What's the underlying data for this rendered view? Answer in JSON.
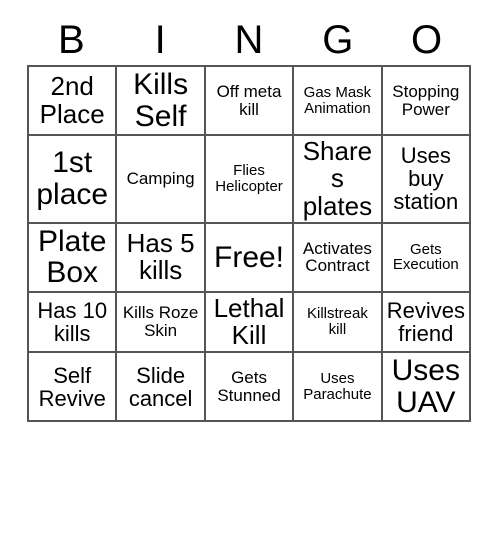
{
  "card": {
    "header": {
      "letters": [
        "B",
        "I",
        "N",
        "G",
        "O"
      ]
    },
    "rows": [
      [
        {
          "text": "2nd Place",
          "size": "sz-lg"
        },
        {
          "text": "Kills Self",
          "size": "sz-xl"
        },
        {
          "text": "Off meta kill",
          "size": "sz-sm"
        },
        {
          "text": "Gas Mask Animation",
          "size": "sz-xs"
        },
        {
          "text": "Stopping Power",
          "size": "sz-sm"
        }
      ],
      [
        {
          "text": "1st place",
          "size": "sz-xl"
        },
        {
          "text": "Camping",
          "size": "sz-sm"
        },
        {
          "text": "Flies Helicopter",
          "size": "sz-xs"
        },
        {
          "text": "Shares plates",
          "size": "sz-lg"
        },
        {
          "text": "Uses buy station",
          "size": "sz-md"
        }
      ],
      [
        {
          "text": "Plate Box",
          "size": "sz-xl"
        },
        {
          "text": "Has 5 kills",
          "size": "sz-lg"
        },
        {
          "text": "Free!",
          "size": "sz-xl"
        },
        {
          "text": "Activates Contract",
          "size": "sz-sm"
        },
        {
          "text": "Gets Execution",
          "size": "sz-xs"
        }
      ],
      [
        {
          "text": "Has 10 kills",
          "size": "sz-md"
        },
        {
          "text": "Kills Roze Skin",
          "size": "sz-sm"
        },
        {
          "text": "Lethal Kill",
          "size": "sz-lg"
        },
        {
          "text": "Killstreak kill",
          "size": "sz-xs"
        },
        {
          "text": "Revives friend",
          "size": "sz-md"
        }
      ],
      [
        {
          "text": "Self Revive",
          "size": "sz-md"
        },
        {
          "text": "Slide cancel",
          "size": "sz-md"
        },
        {
          "text": "Gets Stunned",
          "size": "sz-sm"
        },
        {
          "text": "Uses Parachute",
          "size": "sz-xs"
        },
        {
          "text": "Uses UAV",
          "size": "sz-xl"
        }
      ]
    ],
    "colors": {
      "border": "#555555",
      "background": "#ffffff",
      "text": "#000000"
    }
  }
}
